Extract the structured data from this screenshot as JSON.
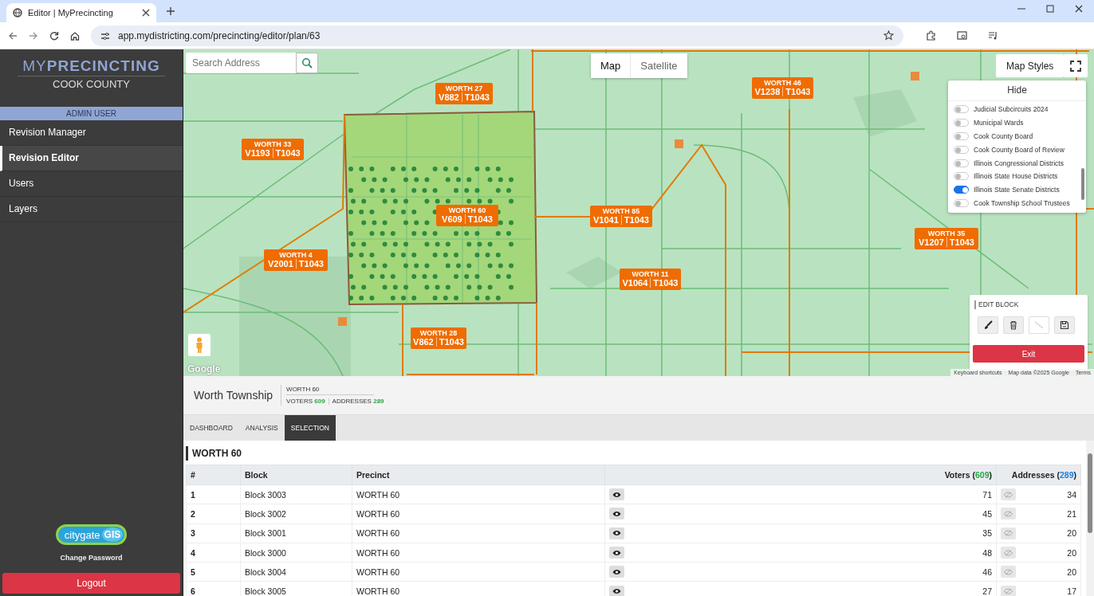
{
  "browser": {
    "tab_title": "Editor | MyPrecincting",
    "url": "app.mydistricting.com/precincting/editor/plan/63"
  },
  "sidebar": {
    "brand": "MY**PRECINCTING**",
    "county": "COOK COUNTY",
    "role": "ADMIN USER",
    "items": [
      {
        "label": "Revision Manager",
        "selected": false
      },
      {
        "label": "Revision Editor",
        "selected": true
      },
      {
        "label": "Users",
        "selected": false
      },
      {
        "label": "Layers",
        "selected": false
      }
    ],
    "logo": {
      "word": "citygate",
      "badge": "GIS"
    },
    "change_password": "Change Password",
    "logout": "Logout"
  },
  "map": {
    "search": {
      "placeholder": "Search Address"
    },
    "map_types": [
      {
        "label": "Map",
        "selected": true
      },
      {
        "label": "Satellite",
        "selected": false
      }
    ],
    "styles_button": "Map Styles",
    "markers": [
      {
        "name": "WORTH 27",
        "voters": "V882",
        "total": "T1043"
      },
      {
        "name": "WORTH 33",
        "voters": "V1193",
        "total": "T1043"
      },
      {
        "name": "WORTH 60",
        "voters": "V609",
        "total": "T1043"
      },
      {
        "name": "WORTH 4",
        "voters": "V2001",
        "total": "T1043"
      },
      {
        "name": "WORTH 28",
        "voters": "V862",
        "total": "T1043"
      },
      {
        "name": "WORTH 85",
        "voters": "V1041",
        "total": "T1043"
      },
      {
        "name": "WORTH 11",
        "voters": "V1064",
        "total": "T1043"
      },
      {
        "name": "WORTH 46",
        "voters": "V1238",
        "total": "T1043"
      },
      {
        "name": "WORTH 35",
        "voters": "V1207",
        "total": "T1043"
      }
    ],
    "layers": {
      "header": "Hide",
      "items": [
        {
          "label": "Judicial Subcircuits 2024",
          "on": false
        },
        {
          "label": "Municipal Wards",
          "on": false
        },
        {
          "label": "Cook County Board",
          "on": false
        },
        {
          "label": "Cook County Board of Review",
          "on": false
        },
        {
          "label": "Illinois Congressional Districts",
          "on": false
        },
        {
          "label": "Illinois State House Districts",
          "on": false
        },
        {
          "label": "Illinois State Senate Districts",
          "on": true
        },
        {
          "label": "Cook Township School Trustees",
          "on": false
        }
      ]
    },
    "edit_block": {
      "title": "EDIT BLOCK",
      "tools": [
        {
          "kind": "brush",
          "disabled": false
        },
        {
          "kind": "trash",
          "disabled": false
        },
        {
          "kind": "line",
          "disabled": true
        },
        {
          "kind": "save",
          "disabled": false
        }
      ],
      "exit": "Exit"
    },
    "google": "Google",
    "attribution": [
      "Keyboard shortcuts",
      "Map data ©2025 Google",
      "Terms"
    ]
  },
  "summary": {
    "township": "Worth Township",
    "precinct": "WORTH 60",
    "voters_label": "VOTERS",
    "voters": "609",
    "addresses_label": "ADDRESSES",
    "addresses": "289"
  },
  "tabs": [
    {
      "label": "DASHBOARD",
      "selected": false
    },
    {
      "label": "ANALYSIS",
      "selected": false
    },
    {
      "label": "SELECTION",
      "selected": true
    }
  ],
  "table": {
    "title": "WORTH 60",
    "columns": [
      {
        "label": "#"
      },
      {
        "label": "Block"
      },
      {
        "label": "Precinct"
      },
      {
        "label": "Voters (",
        "count": "609",
        "close": ")",
        "kind": "voters",
        "shown": true
      },
      {
        "label": "Addresses (",
        "count": "289",
        "close": ")",
        "kind": "addresses",
        "shown": false
      }
    ],
    "rows": [
      [
        "1",
        "Block 3003",
        "WORTH 60",
        "71",
        "34"
      ],
      [
        "2",
        "Block 3002",
        "WORTH 60",
        "45",
        "21"
      ],
      [
        "3",
        "Block 3001",
        "WORTH 60",
        "35",
        "20"
      ],
      [
        "4",
        "Block 3000",
        "WORTH 60",
        "48",
        "20"
      ],
      [
        "5",
        "Block 3004",
        "WORTH 60",
        "46",
        "20"
      ],
      [
        "6",
        "Block 3005",
        "WORTH 60",
        "27",
        "17"
      ]
    ]
  }
}
